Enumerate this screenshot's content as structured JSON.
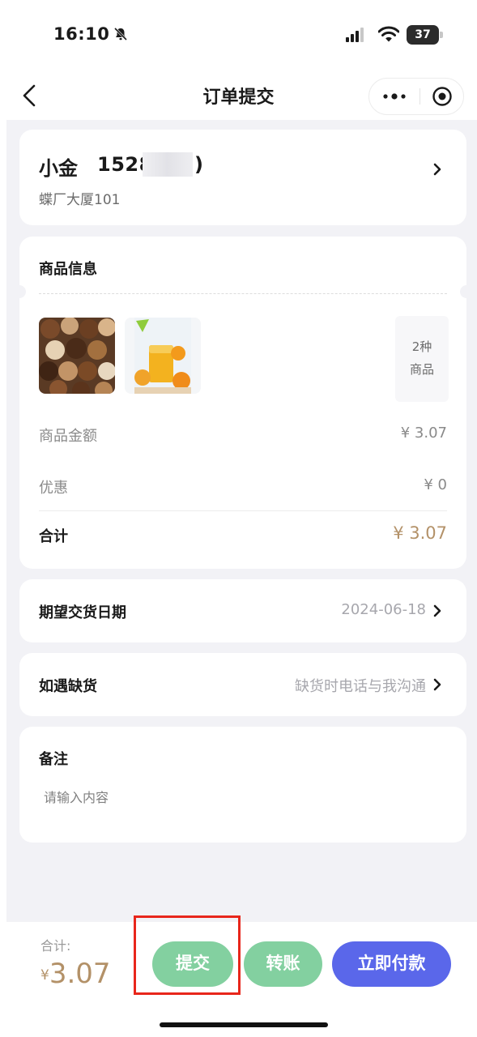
{
  "status_bar": {
    "time": "16:10",
    "battery": "37"
  },
  "nav": {
    "title": "订单提交"
  },
  "address": {
    "name": "小金",
    "phone_visible": "1528",
    "phone_end": ")",
    "detail": "蝶厂大厦101"
  },
  "goods": {
    "section_title": "商品信息",
    "count_line1": "2种",
    "count_line2": "商品",
    "amount_label": "商品金额",
    "amount_value": "¥ 3.07",
    "discount_label": "优惠",
    "discount_value": "¥ 0",
    "total_label": "合计",
    "total_value": "¥ 3.07"
  },
  "delivery_date": {
    "label": "期望交货日期",
    "value": "2024-06-18"
  },
  "shortage": {
    "label": "如遇缺货",
    "value": "缺货时电话与我沟通"
  },
  "remark": {
    "label": "备注",
    "placeholder": "请输入内容"
  },
  "bottom": {
    "total_label": "合计:",
    "currency": "¥",
    "total_amount": "3.07",
    "submit_label": "提交",
    "transfer_label": "转账",
    "pay_label": "立即付款"
  },
  "icons": {
    "back": "chevron-left-icon",
    "more": "more-dots-icon",
    "close": "target-circle-icon",
    "row_arrow": "chevron-right-icon"
  },
  "colors": {
    "accent_gold": "#b39168",
    "green_button": "#83d0a0",
    "pay_button": "#5a67ea",
    "highlight": "#e8261b"
  }
}
